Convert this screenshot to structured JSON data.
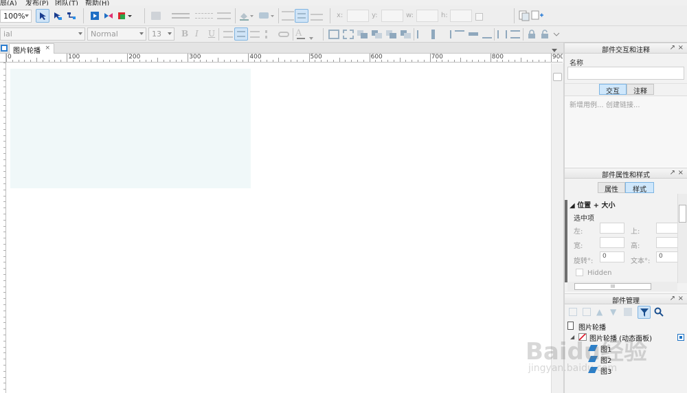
{
  "menu": [
    "局(A)",
    "发布(P)",
    "团队(T)",
    "帮助(H)"
  ],
  "toolbar": {
    "zoom": "100%",
    "font_family": "ial",
    "font_style": "Normal",
    "font_size": "13",
    "x_label": "x:",
    "y_label": "y:",
    "w_label": "w:",
    "h_label": "h:"
  },
  "tabs": [
    {
      "label": "图片轮播",
      "close": "×"
    }
  ],
  "ruler": [
    "0",
    "100",
    "200",
    "300",
    "400",
    "500",
    "600",
    "700",
    "800",
    "900"
  ],
  "interactions_panel": {
    "title": "部件交互和注释",
    "name_label": "名称",
    "name_value": "",
    "tab_interactions": "交互",
    "tab_notes": "注释",
    "new_case": "新增用例...",
    "create_link": "创建链接..."
  },
  "props_panel": {
    "title": "部件属性和样式",
    "tab_props": "属性",
    "tab_style": "样式",
    "section": "位置 + 大小",
    "selected": "选中项",
    "left_label": "左:",
    "top_label": "上:",
    "width_label": "宽:",
    "height_label": "高:",
    "rotate_label": "旋转°:",
    "rotate_value": "0",
    "text_rotate_label": "文本°:",
    "text_rotate_value": "0",
    "hidden_label": "Hidden",
    "scroll_grip": "III"
  },
  "manager_panel": {
    "title": "部件管理",
    "page": "图片轮播",
    "panel_item": "图片轮播 (动态面板)",
    "states": [
      "图1",
      "图2",
      "图3"
    ]
  },
  "panel_controls": {
    "pin": "↗",
    "close": "×"
  },
  "watermark": {
    "line1": "Baidu经验",
    "line2": "jingyan.baidu.com"
  },
  "colors": {
    "dynamic_panel_fill": "#f0f8f9",
    "selected_tab": "#cfe7fb",
    "chrome": "#eeeeee"
  }
}
